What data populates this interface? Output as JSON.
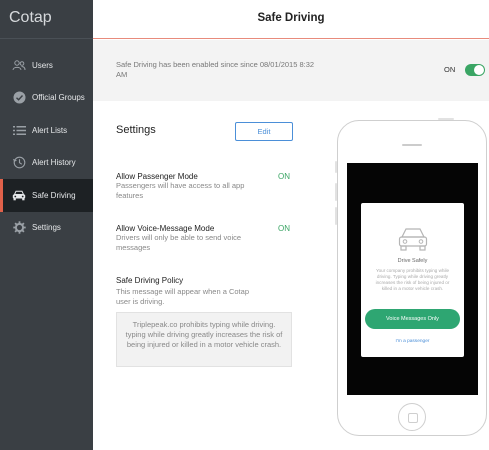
{
  "app": {
    "brand": "Cotap"
  },
  "sidebar": {
    "items": [
      {
        "label": "Users",
        "icon": "users-icon"
      },
      {
        "label": "Official Groups",
        "icon": "check-circle-icon"
      },
      {
        "label": "Alert Lists",
        "icon": "list-icon"
      },
      {
        "label": "Alert History",
        "icon": "history-icon"
      },
      {
        "label": "Safe Driving",
        "icon": "car-icon",
        "active": true
      },
      {
        "label": "Settings",
        "icon": "gear-icon"
      }
    ]
  },
  "header": {
    "title": "Safe Driving"
  },
  "banner": {
    "text": "Safe Driving has been enabled since since 08/01/2015 8:32 AM",
    "state_label": "ON",
    "toggle_on": true
  },
  "settings": {
    "title": "Settings",
    "edit_label": "Edit",
    "passenger": {
      "title": "Allow Passenger Mode",
      "desc": "Passengers will have access to all app features",
      "value": "ON"
    },
    "voice": {
      "title": "Allow Voice-Message Mode",
      "desc": "Drivers will only be able to send voice messages",
      "value": "ON"
    },
    "policy": {
      "title": "Safe Driving Policy",
      "desc": "This message will appear when a Cotap user is driving.",
      "message": "Triplepeak.co prohibits typing while driving. typing while driving greatly increases the risk of being injured or killed in a motor vehicle crash."
    }
  },
  "phone": {
    "modal_title": "Drive Safely",
    "modal_text": "Your company prohibits typing while driving. Typing while driving greatly increases the risk of being injured or killed in a motor vehicle crash.",
    "button_label": "Voice Messages Only",
    "link_label": "I'm a passenger"
  },
  "colors": {
    "accent_green": "#3aa564",
    "accent_blue": "#4b8fd8",
    "sidebar_bg": "#3a3f44",
    "active_marker": "#e0614a"
  }
}
